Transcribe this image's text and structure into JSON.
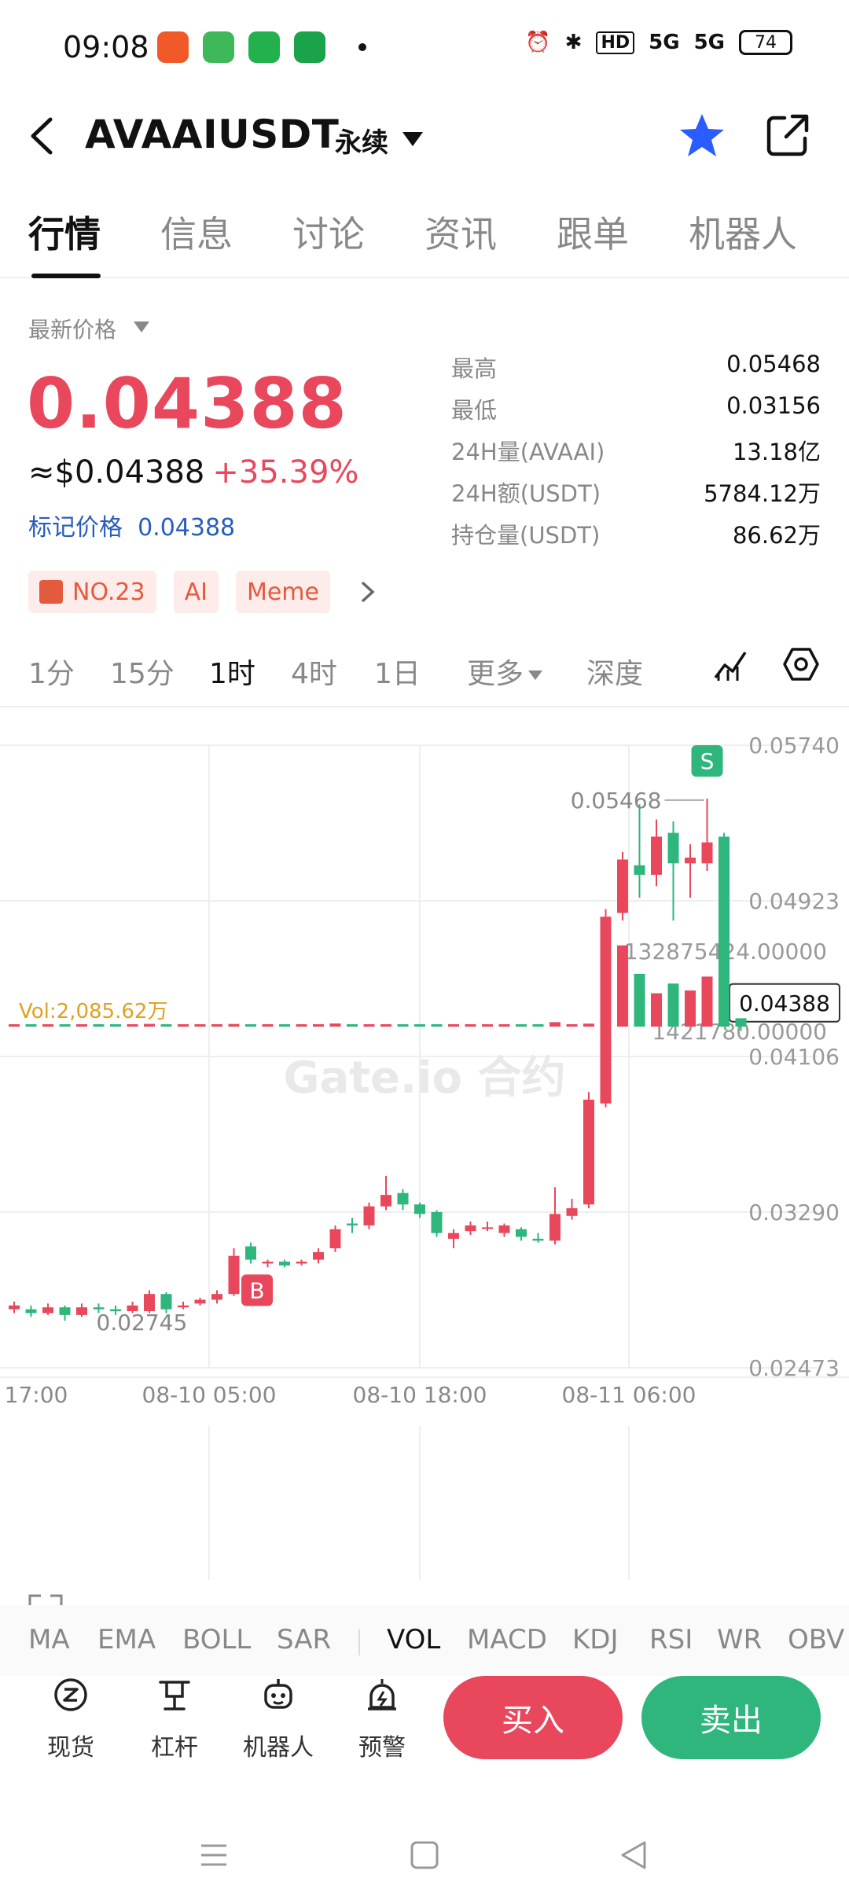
{
  "status_bar": {
    "time": "09:08",
    "network": "5G",
    "hd_badge": "HD",
    "battery": "74"
  },
  "nav": {
    "pair": "AVAAIUSDT",
    "contract_type": "永续"
  },
  "tabs": [
    "行情",
    "信息",
    "讨论",
    "资讯",
    "跟单",
    "机器人"
  ],
  "price": {
    "label": "最新价格",
    "last": "0.04388",
    "usd": "≈$0.04388",
    "change": "+35.39%",
    "mark_label": "标记价格",
    "mark_value": "0.04388"
  },
  "stats": [
    {
      "label": "最高",
      "value": "0.05468"
    },
    {
      "label": "最低",
      "value": "0.03156"
    },
    {
      "label": "24H量(AVAAI)",
      "value": "13.18亿"
    },
    {
      "label": "24H额(USDT)",
      "value": "5784.12万"
    },
    {
      "label": "持仓量(USDT)",
      "value": "86.62万"
    }
  ],
  "tags": [
    "NO.23",
    "AI",
    "Meme"
  ],
  "intervals": [
    "1分",
    "15分",
    "1时",
    "4时",
    "1日",
    "更多",
    "深度"
  ],
  "active_interval": "1时",
  "chart_data": {
    "type": "candlestick",
    "pair": "AVAAIUSDT",
    "interval": "1时",
    "price_axis": [
      "0.05740",
      "0.04923",
      "0.04106",
      "0.03290",
      "0.02473"
    ],
    "ylim": [
      0.02473,
      0.0574
    ],
    "time_axis": [
      "17:00",
      "08-10 05:00",
      "08-10 18:00",
      "08-11 06:00"
    ],
    "high_marker": "0.05468",
    "low_marker": "0.02745",
    "current_price": "0.04388",
    "signals": {
      "buy": "B",
      "sell": "S"
    },
    "watermark": "Gate.io 合约",
    "candles": [
      {
        "o": 0.0278,
        "c": 0.028,
        "h": 0.0282,
        "l": 0.0276
      },
      {
        "o": 0.0278,
        "c": 0.0276,
        "h": 0.028,
        "l": 0.0274
      },
      {
        "o": 0.0276,
        "c": 0.0279,
        "h": 0.0281,
        "l": 0.0275
      },
      {
        "o": 0.0279,
        "c": 0.0275,
        "h": 0.028,
        "l": 0.0272
      },
      {
        "o": 0.0275,
        "c": 0.0279,
        "h": 0.0281,
        "l": 0.0274
      },
      {
        "o": 0.0279,
        "c": 0.0278,
        "h": 0.0281,
        "l": 0.0276
      },
      {
        "o": 0.0278,
        "c": 0.0277,
        "h": 0.028,
        "l": 0.0275
      },
      {
        "o": 0.0277,
        "c": 0.028,
        "h": 0.0282,
        "l": 0.0276
      },
      {
        "o": 0.0277,
        "c": 0.0286,
        "h": 0.0288,
        "l": 0.0276
      },
      {
        "o": 0.0286,
        "c": 0.0278,
        "h": 0.0287,
        "l": 0.0276
      },
      {
        "o": 0.0279,
        "c": 0.028,
        "h": 0.0282,
        "l": 0.0278
      },
      {
        "o": 0.0281,
        "c": 0.0283,
        "h": 0.0284,
        "l": 0.028
      },
      {
        "o": 0.0283,
        "c": 0.0286,
        "h": 0.0288,
        "l": 0.0281
      },
      {
        "o": 0.0286,
        "c": 0.0306,
        "h": 0.031,
        "l": 0.0285
      },
      {
        "o": 0.0311,
        "c": 0.0304,
        "h": 0.0313,
        "l": 0.0302
      },
      {
        "o": 0.0302,
        "c": 0.0303,
        "h": 0.0304,
        "l": 0.03
      },
      {
        "o": 0.0303,
        "c": 0.0301,
        "h": 0.0304,
        "l": 0.03
      },
      {
        "o": 0.0302,
        "c": 0.0303,
        "h": 0.0304,
        "l": 0.0301
      },
      {
        "o": 0.0304,
        "c": 0.0308,
        "h": 0.031,
        "l": 0.0302
      },
      {
        "o": 0.031,
        "c": 0.032,
        "h": 0.0322,
        "l": 0.0308
      },
      {
        "o": 0.0323,
        "c": 0.0322,
        "h": 0.0326,
        "l": 0.0318
      },
      {
        "o": 0.0322,
        "c": 0.0332,
        "h": 0.0334,
        "l": 0.032
      },
      {
        "o": 0.0332,
        "c": 0.0338,
        "h": 0.0348,
        "l": 0.033
      },
      {
        "o": 0.0339,
        "c": 0.0333,
        "h": 0.0341,
        "l": 0.033
      },
      {
        "o": 0.0333,
        "c": 0.0328,
        "h": 0.0334,
        "l": 0.0326
      },
      {
        "o": 0.0329,
        "c": 0.0318,
        "h": 0.033,
        "l": 0.0316
      },
      {
        "o": 0.0315,
        "c": 0.0318,
        "h": 0.032,
        "l": 0.031
      },
      {
        "o": 0.0319,
        "c": 0.0322,
        "h": 0.0324,
        "l": 0.0317
      },
      {
        "o": 0.0321,
        "c": 0.0321,
        "h": 0.0324,
        "l": 0.0319
      },
      {
        "o": 0.0318,
        "c": 0.0322,
        "h": 0.0323,
        "l": 0.0316
      },
      {
        "o": 0.032,
        "c": 0.0316,
        "h": 0.0321,
        "l": 0.0314
      },
      {
        "o": 0.0315,
        "c": 0.0314,
        "h": 0.0318,
        "l": 0.0313
      },
      {
        "o": 0.0314,
        "c": 0.0328,
        "h": 0.0342,
        "l": 0.0312
      },
      {
        "o": 0.0327,
        "c": 0.0331,
        "h": 0.0336,
        "l": 0.0325
      },
      {
        "o": 0.0333,
        "c": 0.0388,
        "h": 0.0392,
        "l": 0.0331
      },
      {
        "o": 0.0386,
        "c": 0.0484,
        "h": 0.0488,
        "l": 0.0384
      },
      {
        "o": 0.0486,
        "c": 0.0514,
        "h": 0.0518,
        "l": 0.0482
      },
      {
        "o": 0.0511,
        "c": 0.0506,
        "h": 0.0543,
        "l": 0.0494
      },
      {
        "o": 0.0506,
        "c": 0.0526,
        "h": 0.0535,
        "l": 0.05
      },
      {
        "o": 0.0528,
        "c": 0.0512,
        "h": 0.0534,
        "l": 0.0482
      },
      {
        "o": 0.0512,
        "c": 0.0515,
        "h": 0.0522,
        "l": 0.0494
      },
      {
        "o": 0.0512,
        "c": 0.0523,
        "h": 0.0546,
        "l": 0.0508
      },
      {
        "o": 0.0526,
        "c": 0.0439,
        "h": 0.0528,
        "l": 0.0435
      },
      {
        "o": 0.0437,
        "c": 0.0431,
        "h": 0.044,
        "l": 0.0424
      }
    ],
    "volume": {
      "label": "Vol:2,085.62万",
      "axis": [
        "132875424.00000",
        "1421780.00000"
      ],
      "values": [
        1.4,
        1.4,
        1.4,
        1.5,
        1.5,
        1.4,
        1.4,
        1.6,
        3.9,
        2.4,
        1.6,
        1.7,
        1.7,
        3.8,
        2.8,
        1.8,
        1.6,
        1.7,
        1.8,
        4.5,
        2.5,
        1.8,
        1.9,
        1.8,
        1.7,
        1.7,
        1.8,
        2.0,
        2.2,
        2.0,
        2.1,
        2.6,
        6.4,
        2.6,
        4.3,
        110.0,
        117.0,
        76.0,
        48.0,
        62.0,
        52.0,
        72.0,
        120.0,
        12.0
      ]
    }
  },
  "indicators": [
    "MA",
    "EMA",
    "BOLL",
    "SAR",
    "VOL",
    "MACD",
    "KDJ",
    "RSI",
    "WR",
    "OBV"
  ],
  "active_indicator": "VOL",
  "bottom_bar": {
    "items": [
      "现货",
      "杠杆",
      "机器人",
      "预警"
    ],
    "buy": "买入",
    "sell": "卖出"
  },
  "colors": {
    "up": "#e8475c",
    "down": "#2eb67d",
    "accent": "#2a5dbb",
    "star": "#2a5dff"
  }
}
